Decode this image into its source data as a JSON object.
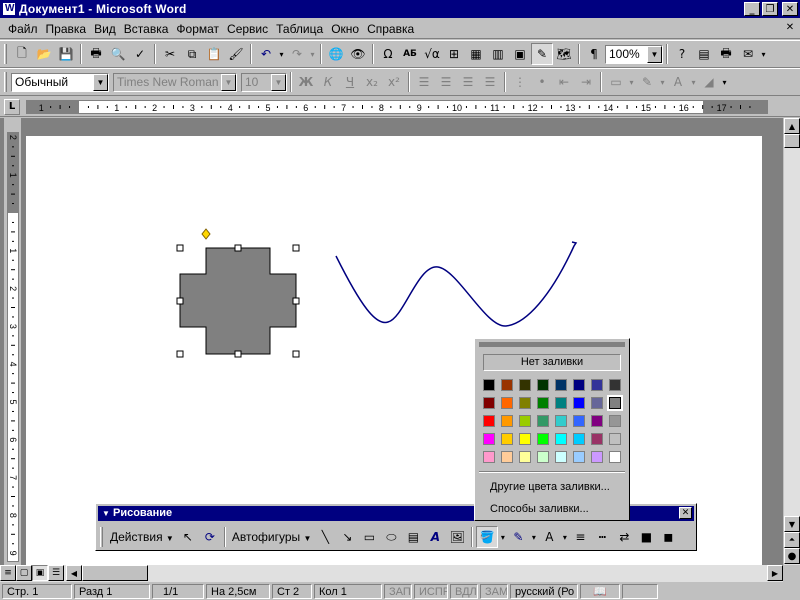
{
  "window": {
    "title": "Документ1 - Microsoft Word"
  },
  "menu": {
    "items": [
      "Файл",
      "Правка",
      "Вид",
      "Вставка",
      "Формат",
      "Сервис",
      "Таблица",
      "Окно",
      "Справка"
    ]
  },
  "standard_toolbar": {
    "zoom": "100%"
  },
  "formatting_toolbar": {
    "style": "Обычный",
    "font": "Times New Roman",
    "size": "10",
    "bold_label": "Ж",
    "italic_label": "К",
    "underline_label": "Ч"
  },
  "ruler": {
    "labels": [
      "1",
      "1",
      "2",
      "3",
      "4",
      "5",
      "6",
      "7",
      "8",
      "9",
      "10",
      "11",
      "12",
      "13",
      "14",
      "15",
      "16",
      "17"
    ],
    "vertical_labels": [
      "2",
      "1",
      "1",
      "2",
      "3",
      "4",
      "5",
      "6",
      "7",
      "8",
      "9"
    ]
  },
  "fill_palette": {
    "no_fill": "Нет заливки",
    "more_colors": "Другие цвета заливки...",
    "fill_effects": "Способы заливки...",
    "colors": [
      "#000000",
      "#993300",
      "#333300",
      "#003300",
      "#003366",
      "#000080",
      "#333399",
      "#333333",
      "#800000",
      "#FF6600",
      "#808000",
      "#008000",
      "#008080",
      "#0000FF",
      "#666699",
      "#808080",
      "#FF0000",
      "#FF9900",
      "#99CC00",
      "#339966",
      "#33CCCC",
      "#3366FF",
      "#800080",
      "#969696",
      "#FF00FF",
      "#FFCC00",
      "#FFFF00",
      "#00FF00",
      "#00FFFF",
      "#00CCFF",
      "#993366",
      "#C0C0C0",
      "#FF99CC",
      "#FFCC99",
      "#FFFF99",
      "#CCFFCC",
      "#CCFFFF",
      "#99CCFF",
      "#CC99FF",
      "#FFFFFF"
    ],
    "selected_color": "#808080"
  },
  "drawing_toolbar": {
    "title": "Рисование",
    "actions_label": "Действия",
    "autoshapes_label": "Автофигуры"
  },
  "shapes": {
    "cross_fill": "#808080",
    "curve_color": "#000080"
  },
  "status_bar": {
    "page": "Стр. 1",
    "section": "Разд 1",
    "pages": "1/1",
    "at": "На 2,5см",
    "line": "Ст 2",
    "col": "Кол 1",
    "rec": "ЗАП",
    "trk": "ИСПР",
    "ext": "ВДЛ",
    "ovr": "ЗАМ",
    "lang": "русский (Ро"
  }
}
